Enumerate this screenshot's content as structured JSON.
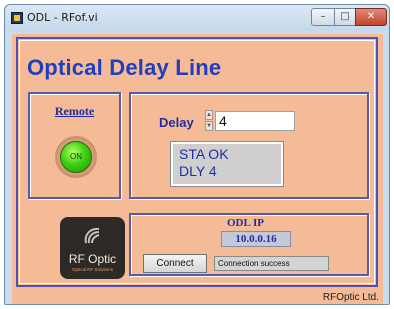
{
  "window": {
    "title": "ODL - RFof.vi",
    "buttons": {
      "minimize": "–",
      "maximize": "□",
      "close": "✕"
    }
  },
  "panel": {
    "title": "Optical Delay Line",
    "footer": "RFOptic Ltd."
  },
  "remote": {
    "label": "Remote",
    "led_text": "ON",
    "led_color": "#3ed214"
  },
  "delay": {
    "label": "Delay",
    "value": "4",
    "status_lines": [
      "STA OK",
      "DLY 4"
    ]
  },
  "logo": {
    "text": "RF Optic",
    "subtext": "Optical RF Solutions"
  },
  "odl_ip": {
    "label": "ODL IP",
    "address": "10.0.0.16",
    "connect_label": "Connect",
    "connection_status": "Connection success"
  },
  "colors": {
    "panel_bg": "#f4bb96",
    "accent_blue": "#1f3fc0",
    "frame": "#5050b0"
  },
  "icons": {
    "app": "labview-vi-icon",
    "spinner_up": "triangle-up-icon",
    "spinner_down": "triangle-down-icon",
    "logo": "rf-optic-logo-icon"
  }
}
